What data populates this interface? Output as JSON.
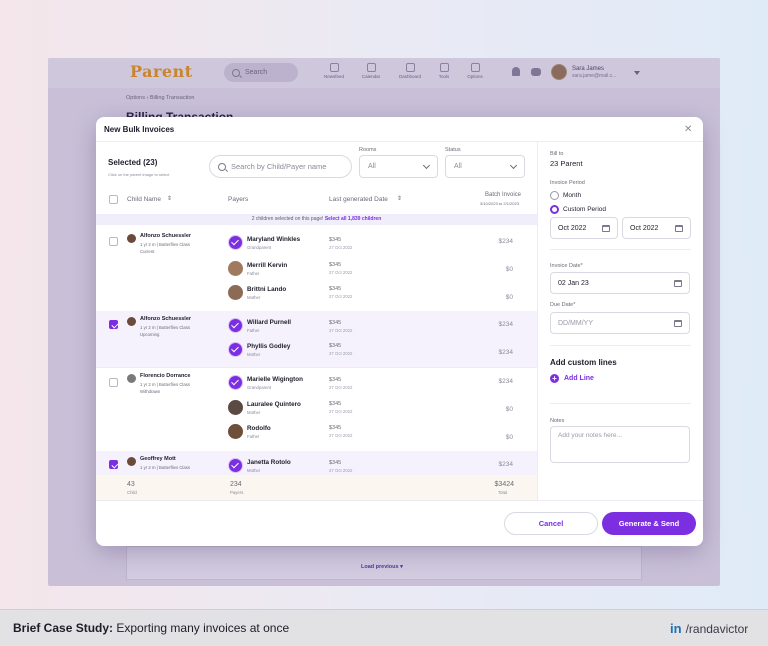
{
  "app": {
    "logo": "Parent",
    "search_placeholder": "Search",
    "nav": [
      "Newsfeed",
      "Calendar",
      "Dashboard",
      "Tools",
      "Options"
    ],
    "user_name": "Sara James",
    "user_email": "sara.jame@mail.c...",
    "breadcrumb": "Options   ›   Billing Transaction",
    "page_title": "Billing Transaction",
    "load_previous": "Load previous  ▾"
  },
  "modal": {
    "title": "New Bulk Invoices",
    "close": "✕",
    "selected": "Selected (23)",
    "selected_hint": "Click on the parent image to select",
    "search_placeholder": "Search by Child/Payer name",
    "rooms_label": "Rooms",
    "rooms_value": "All",
    "status_label": "Status",
    "status_value": "All",
    "columns": {
      "child": "Child Name",
      "payers": "Payers",
      "last_generated": "Last generated Date",
      "batch": "Batch Invoice",
      "batch_range": "3/10/2023 to 2/1/2023"
    },
    "banner_text": "2 children selected on this page!",
    "banner_link": "Select all 1,839 children",
    "groups": [
      {
        "child": "Alfonzo Schuessler",
        "line1": "1 yr 2 m | Butterflies Class",
        "line2": "Current",
        "payers": [
          {
            "name": "Maryland Winkles",
            "role": "Grandparent",
            "amount": "$345",
            "date": "27 Oct 2022",
            "batch": "$234"
          },
          {
            "name": "Merrill Kervin",
            "role": "Father",
            "amount": "$345",
            "date": "27 Oct 2022",
            "batch": "$0"
          },
          {
            "name": "Brittni Lando",
            "role": "Mother",
            "amount": "$345",
            "date": "27 Oct 2022",
            "batch": "$0"
          }
        ]
      },
      {
        "child": "Alfonzo Schuessler",
        "line1": "1 yr 2 m | Butterflies Class",
        "line2": "Upcoming",
        "payers": [
          {
            "name": "Willard Purnell",
            "role": "Father",
            "amount": "$345",
            "date": "27 Oct 2022",
            "batch": "$234"
          },
          {
            "name": "Phyllis Godley",
            "role": "Mother",
            "amount": "$345",
            "date": "27 Oct 2022",
            "batch": "$234"
          }
        ]
      },
      {
        "child": "Florencio Dorrance",
        "line1": "1 yr 2 m | Butterflies Class",
        "line2": "Withdrawn",
        "payers": [
          {
            "name": "Marielle Wigington",
            "role": "Grandparent",
            "amount": "$345",
            "date": "27 Oct 2022",
            "batch": "$234"
          },
          {
            "name": "Lauralee Quintero",
            "role": "Mother",
            "amount": "$345",
            "date": "27 Oct 2022",
            "batch": "$0"
          },
          {
            "name": "Rodolfo",
            "role": "Father",
            "amount": "$345",
            "date": "27 Oct 2022",
            "batch": "$0"
          }
        ]
      },
      {
        "child": "Geoffrey Mott",
        "line1": "1 yr 2 m | Butterflies Class",
        "line2": "",
        "payers": [
          {
            "name": "Janetta Rotolo",
            "role": "Mother",
            "amount": "$345",
            "date": "27 Oct 2022",
            "batch": "$234"
          }
        ]
      }
    ],
    "totals": {
      "child_value": "43",
      "child_label": "Child",
      "payers_value": "234",
      "payers_label": "Payers",
      "total_value": "$3424",
      "total_label": "Total"
    },
    "right": {
      "bill_to_label": "Bill to",
      "bill_to_value": "23 Parent",
      "period_label": "Invoice Period",
      "period_month": "Month",
      "period_custom": "Custom Period",
      "from": "Oct 2022",
      "to": "Oct 2022",
      "invoice_date_label": "Invoice Date*",
      "invoice_date_value": "02 Jan 23",
      "due_date_label": "Due Date*",
      "due_date_placeholder": "DD/MM/YY",
      "custom_lines_title": "Add custom lines",
      "add_line": "Add Line",
      "notes_label": "Notes",
      "notes_placeholder": "Add your notes here..."
    },
    "cancel": "Cancel",
    "generate": "Generate & Send"
  },
  "caption": {
    "bold": "Brief Case Study:",
    "text": " Exporting many invoices at once",
    "linkedin": "in",
    "handle": "/randavictor"
  },
  "colors": {
    "accent": "#7b2fe0",
    "brand": "#c9852b"
  }
}
